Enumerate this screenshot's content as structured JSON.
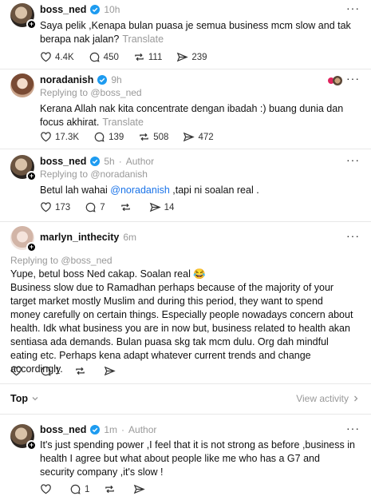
{
  "posts": [
    {
      "author": "boss_ned",
      "time": "10h",
      "text": "Saya pelik ,Kenapa bulan puasa je semua business mcm slow and tak berapa nak jalan?",
      "translate": "Translate",
      "likes": "4.4K",
      "replies": "450",
      "reposts": "111",
      "shares": "239"
    },
    {
      "author": "noradanish",
      "time": "9h",
      "replying": "Replying to @boss_ned",
      "text": "Kerana Allah nak kita concentrate dengan ibadah :) buang dunia dan focus akhirat.",
      "translate": "Translate",
      "likes": "17.3K",
      "replies": "139",
      "reposts": "508",
      "shares": "472"
    },
    {
      "author": "boss_ned",
      "time": "5h",
      "author_tag": "Author",
      "replying": "Replying to @noradanish",
      "text_before": "Betul lah wahai ",
      "mention": "@noradanish",
      "text_after": " ,tapi ni soalan real .",
      "likes": "173",
      "replies": "7",
      "reposts": "",
      "shares": "14"
    },
    {
      "author": "marlyn_inthecity",
      "time": "6m",
      "replying": "Replying to @boss_ned",
      "text_line1": "Yupe, betul boss Ned cakap. Soalan real 😂",
      "text_body": "Business slow due to Ramadhan perhaps because of the majority of your target market mostly Muslim and during this period, they want to spend money carefully on certain things. Especially people nowadays concern about health. Idk what business you are in now but, business related to health akan sentiasa ada demands. Bulan puasa skg tak mcm dulu. Org dah mindful eating etc. Perhaps kena adapt whatever current trends and change accordingly.",
      "likes": "",
      "replies": "1",
      "reposts": "",
      "shares": ""
    },
    {
      "author": "boss_ned",
      "time": "1m",
      "author_tag": "Author",
      "text": "It's just spending power ,I feel that it is not strong as before ,business in health I agree but what about people like me who has a G7 and security company ,it's slow !",
      "likes": "",
      "replies": "1",
      "reposts": "",
      "shares": ""
    }
  ],
  "sort": {
    "label": "Top",
    "view_activity": "View activity"
  },
  "colors": {
    "verified": "#1d9bf0",
    "mention": "#1a73e8",
    "muted": "#999999"
  }
}
